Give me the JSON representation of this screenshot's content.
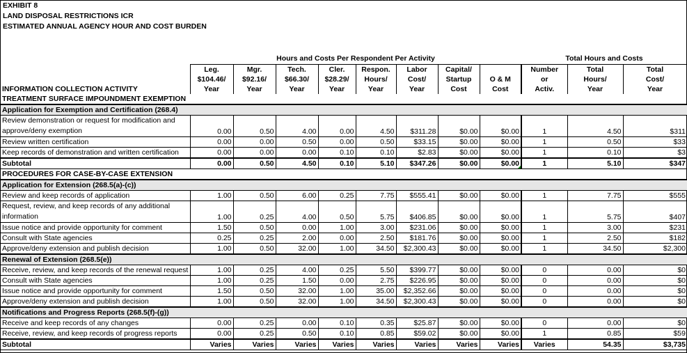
{
  "header": {
    "exhibit": "EXHIBIT 8",
    "title": "LAND DISPOSAL RESTRICTIONS ICR",
    "subtitle": "ESTIMATED ANNUAL AGENCY HOUR AND COST BURDEN",
    "group_per_respondent": "Hours and Costs Per Respondent Per Activity",
    "group_totals": "Total Hours and Costs"
  },
  "columns": [
    {
      "l1": "",
      "l2": "",
      "l3": "INFORMATION COLLECTION ACTIVITY"
    },
    {
      "l1": "Leg.",
      "l2": "$104.46/",
      "l3": "Year"
    },
    {
      "l1": "Mgr.",
      "l2": "$92.16/",
      "l3": "Year"
    },
    {
      "l1": "Tech.",
      "l2": "$66.30/",
      "l3": "Year"
    },
    {
      "l1": "Cler.",
      "l2": "$28.29/",
      "l3": "Year"
    },
    {
      "l1": "Respon.",
      "l2": "Hours/",
      "l3": "Year"
    },
    {
      "l1": "Labor",
      "l2": "Cost/",
      "l3": "Year"
    },
    {
      "l1": "Capital/",
      "l2": "Startup",
      "l3": "Cost"
    },
    {
      "l1": "",
      "l2": "O & M",
      "l3": "Cost"
    },
    {
      "l1": "Number",
      "l2": "or",
      "l3": "Activ."
    },
    {
      "l1": "Total",
      "l2": "Hours/",
      "l3": "Year"
    },
    {
      "l1": "Total",
      "l2": "Cost/",
      "l3": "Year"
    }
  ],
  "rows": [
    {
      "type": "plain",
      "label": "TREATMENT SURFACE IMPOUNDMENT EXEMPTION"
    },
    {
      "type": "section",
      "label": "Application for Exemption and Certification (268.4)"
    },
    {
      "type": "data",
      "tall": true,
      "label": "Review demonstration or request for modification and approve/deny exemption",
      "v": [
        "0.00",
        "0.50",
        "4.00",
        "0.00",
        "4.50",
        "$311.28",
        "$0.00",
        "$0.00",
        "1",
        "4.50",
        "$311"
      ]
    },
    {
      "type": "data",
      "label": "Review written certification",
      "v": [
        "0.00",
        "0.00",
        "0.50",
        "0.00",
        "0.50",
        "$33.15",
        "$0.00",
        "$0.00",
        "1",
        "0.50",
        "$33"
      ]
    },
    {
      "type": "data",
      "label": "Keep records of demonstration and written certification",
      "v": [
        "0.00",
        "0.00",
        "0.00",
        "0.10",
        "0.10",
        "$2.83",
        "$0.00",
        "$0.00",
        "1",
        "0.10",
        "$3"
      ]
    },
    {
      "type": "subtotal",
      "label": "Subtotal",
      "v": [
        "0.00",
        "0.50",
        "4.50",
        "0.10",
        "5.10",
        "$347.26",
        "$0.00",
        "$0.00",
        "1",
        "5.10",
        "$347"
      ]
    },
    {
      "type": "plain",
      "label": "PROCEDURES FOR CASE-BY-CASE EXTENSION"
    },
    {
      "type": "section",
      "label": "Application for Extension (268.5(a)-(c))"
    },
    {
      "type": "data",
      "label": "Review and keep records of application",
      "v": [
        "1.00",
        "0.50",
        "6.00",
        "0.25",
        "7.75",
        "$555.41",
        "$0.00",
        "$0.00",
        "1",
        "7.75",
        "$555"
      ]
    },
    {
      "type": "data",
      "tall": true,
      "label": "Request, review, and keep records of any additional information",
      "v": [
        "1.00",
        "0.25",
        "4.00",
        "0.50",
        "5.75",
        "$406.85",
        "$0.00",
        "$0.00",
        "1",
        "5.75",
        "$407"
      ]
    },
    {
      "type": "data",
      "label": "Issue notice and provide opportunity for comment",
      "v": [
        "1.50",
        "0.50",
        "0.00",
        "1.00",
        "3.00",
        "$231.06",
        "$0.00",
        "$0.00",
        "1",
        "3.00",
        "$231"
      ]
    },
    {
      "type": "data",
      "label": "Consult with State agencies",
      "v": [
        "0.25",
        "0.25",
        "2.00",
        "0.00",
        "2.50",
        "$181.76",
        "$0.00",
        "$0.00",
        "1",
        "2.50",
        "$182"
      ]
    },
    {
      "type": "data",
      "label": "Approve/deny extension and publish decision",
      "v": [
        "1.00",
        "0.50",
        "32.00",
        "1.00",
        "34.50",
        "$2,300.43",
        "$0.00",
        "$0.00",
        "1",
        "34.50",
        "$2,300"
      ]
    },
    {
      "type": "section",
      "label": "Renewal of Extension (268.5(e))"
    },
    {
      "type": "data",
      "label": "Receive, review, and keep records of the renewal request",
      "v": [
        "1.00",
        "0.25",
        "4.00",
        "0.25",
        "5.50",
        "$399.77",
        "$0.00",
        "$0.00",
        "0",
        "0.00",
        "$0"
      ]
    },
    {
      "type": "data",
      "label": "Consult with State agencies",
      "v": [
        "1.00",
        "0.25",
        "1.50",
        "0.00",
        "2.75",
        "$226.95",
        "$0.00",
        "$0.00",
        "0",
        "0.00",
        "$0"
      ]
    },
    {
      "type": "data",
      "label": "Issue notice and provide opportunity for comment",
      "v": [
        "1.50",
        "0.50",
        "32.00",
        "1.00",
        "35.00",
        "$2,352.66",
        "$0.00",
        "$0.00",
        "0",
        "0.00",
        "$0"
      ]
    },
    {
      "type": "data",
      "label": "Approve/deny extension and publish decision",
      "v": [
        "1.00",
        "0.50",
        "32.00",
        "1.00",
        "34.50",
        "$2,300.43",
        "$0.00",
        "$0.00",
        "0",
        "0.00",
        "$0"
      ]
    },
    {
      "type": "section",
      "label": "Notifications and Progress Reports (268.5(f)-(g))"
    },
    {
      "type": "data",
      "label": "Receive and keep records of any changes",
      "v": [
        "0.00",
        "0.25",
        "0.00",
        "0.10",
        "0.35",
        "$25.87",
        "$0.00",
        "$0.00",
        "0",
        "0.00",
        "$0"
      ]
    },
    {
      "type": "data",
      "label": "Receive, review, and keep records of progress reports",
      "v": [
        "0.00",
        "0.25",
        "0.50",
        "0.10",
        "0.85",
        "$59.02",
        "$0.00",
        "$0.00",
        "1",
        "0.85",
        "$59"
      ]
    },
    {
      "type": "subtotal",
      "label": "Subtotal",
      "v": [
        "Varies",
        "Varies",
        "Varies",
        "Varies",
        "Varies",
        "Varies",
        "Varies",
        "Varies",
        "Varies",
        "54.35",
        "$3,735"
      ]
    }
  ]
}
